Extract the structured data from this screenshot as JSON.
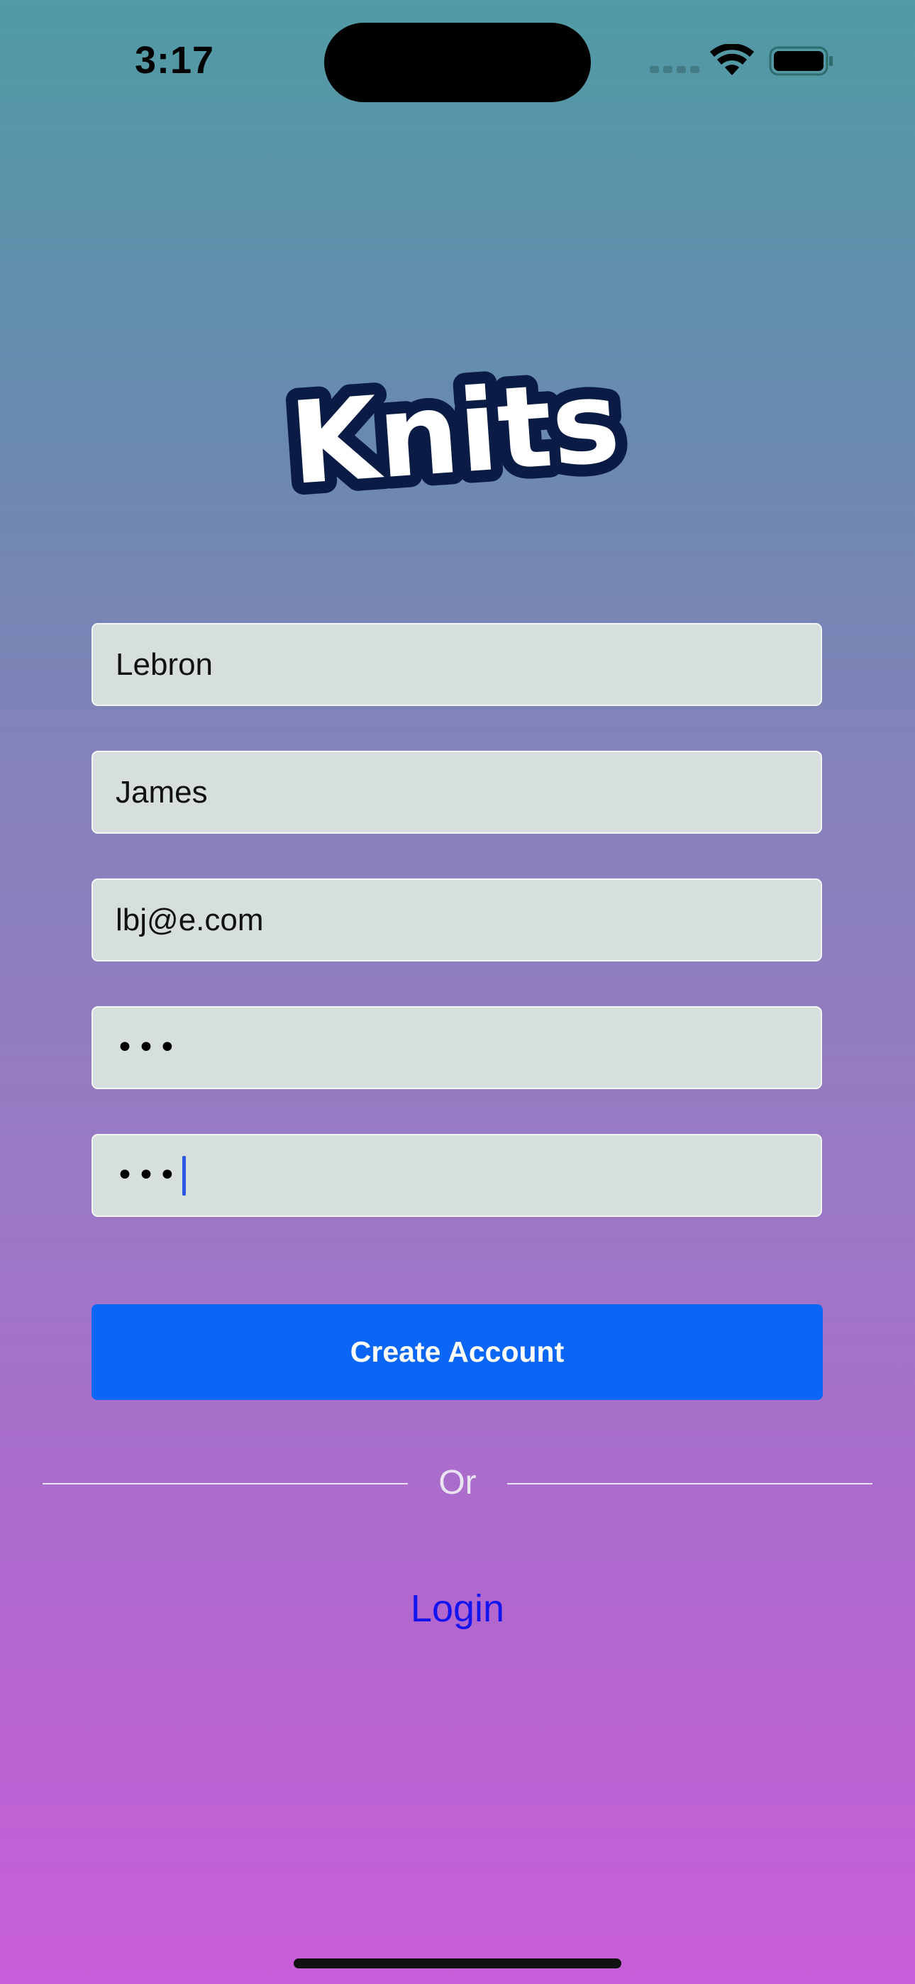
{
  "status_bar": {
    "time": "3:17"
  },
  "logo": {
    "text": "Knits",
    "colors": {
      "fill": "#ffffff",
      "outline": "#0a1c45"
    }
  },
  "form": {
    "first_name": "Lebron",
    "last_name": "James",
    "email": "lbj@e.com",
    "password_mask": "•••",
    "confirm_password_mask": "•••"
  },
  "actions": {
    "create_account_label": "Create Account",
    "divider_label": "Or",
    "login_label": "Login"
  },
  "colors": {
    "primary_button": "#0b66f6",
    "login_link": "#1414f0",
    "field_background": "#d6dfde",
    "caret": "#2b59e9",
    "gradient_top": "#509ba4",
    "gradient_bottom": "#c85ed9"
  }
}
